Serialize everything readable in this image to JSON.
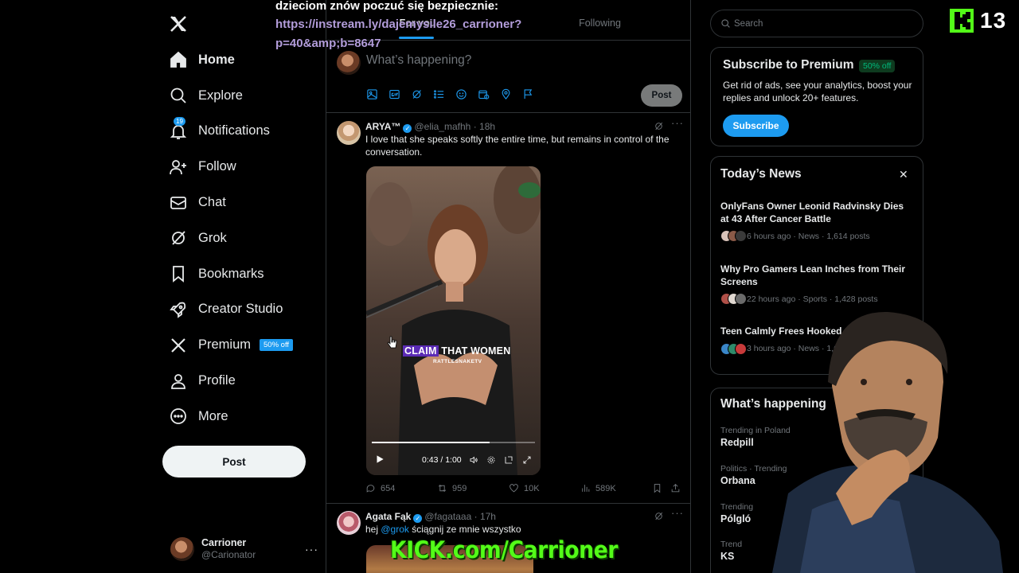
{
  "nav": {
    "items": [
      {
        "label": "Home",
        "icon": "home-icon",
        "active": true
      },
      {
        "label": "Explore",
        "icon": "search-icon"
      },
      {
        "label": "Notifications",
        "icon": "bell-icon",
        "badge": "19"
      },
      {
        "label": "Follow",
        "icon": "person-plus-icon"
      },
      {
        "label": "Chat",
        "icon": "envelope-icon"
      },
      {
        "label": "Grok",
        "icon": "grok-icon"
      },
      {
        "label": "Bookmarks",
        "icon": "bookmark-icon"
      },
      {
        "label": "Creator Studio",
        "icon": "rocket-icon"
      },
      {
        "label": "Premium",
        "icon": "x-icon",
        "tag": "50% off"
      },
      {
        "label": "Profile",
        "icon": "person-icon"
      },
      {
        "label": "More",
        "icon": "more-circle-icon"
      }
    ],
    "post_button": "Post",
    "account": {
      "name": "Carrioner",
      "handle": "@Carionator"
    }
  },
  "feed": {
    "tabs": [
      {
        "label": "For you"
      },
      {
        "label": "Following"
      }
    ],
    "composer": {
      "placeholder": "What’s happening?",
      "post_button": "Post"
    },
    "tweets": [
      {
        "name": "ARYA™",
        "handle": "@elia_mafhh",
        "time": "18h",
        "text": "I love that she speaks softly the entire time, but remains in control of the conversation.",
        "video": {
          "caption_highlight": "CLAIM",
          "caption_rest": " THAT WOMEN",
          "watermark": "RATTLESNAKETV",
          "time": "0:43 / 1:00",
          "progress": 0.72
        },
        "stats": {
          "replies": "654",
          "reposts": "959",
          "likes": "10K",
          "views": "589K"
        }
      },
      {
        "name": "Agata Fąk",
        "handle": "@fagataaa",
        "time": "17h",
        "text_prefix": "hej ",
        "mention": "@grok",
        "text_suffix": " ściągnij ze mnie wszystko"
      }
    ]
  },
  "sidebar": {
    "search_placeholder": "Search",
    "premium": {
      "title": "Subscribe to Premium",
      "badge": "50% off",
      "description": "Get rid of ads, see your analytics, boost your replies and unlock 20+ features.",
      "button": "Subscribe"
    },
    "news": {
      "title": "Today’s News",
      "items": [
        {
          "headline": "OnlyFans Owner Leonid Radvinsky Dies at 43 After Cancer Battle",
          "meta": "6 hours ago · News · 1,614 posts"
        },
        {
          "headline": "Why Pro Gamers Lean Inches from Their Screens",
          "meta": "22 hours ago · Sports · 1,428 posts"
        },
        {
          "headline": "Teen Calmly Frees Hooked Shark Beach",
          "meta": "3 hours ago · News · 1,600"
        }
      ]
    },
    "happening": {
      "title": "What’s happening",
      "trends": [
        {
          "context": "Trending in Poland",
          "name": "Redpill"
        },
        {
          "context": "Politics · Trending",
          "name": "Orbana"
        },
        {
          "context": "Trending",
          "name": "Pólgló"
        },
        {
          "context": "Trend",
          "name": "KS"
        }
      ]
    }
  },
  "overlay": {
    "line1": "dzieciom znów poczuć się bezpiecznie:",
    "line2": "https://instream.ly/dajemysile26_carrioner?",
    "line3": "p=40&amp;b=8647",
    "viewer_count": "13",
    "banner": "KICK.com/Carrioner"
  },
  "colors": {
    "accent": "#1d9bf0",
    "background": "#000000",
    "kick_green": "#53fc18",
    "border": "#2f3336"
  }
}
